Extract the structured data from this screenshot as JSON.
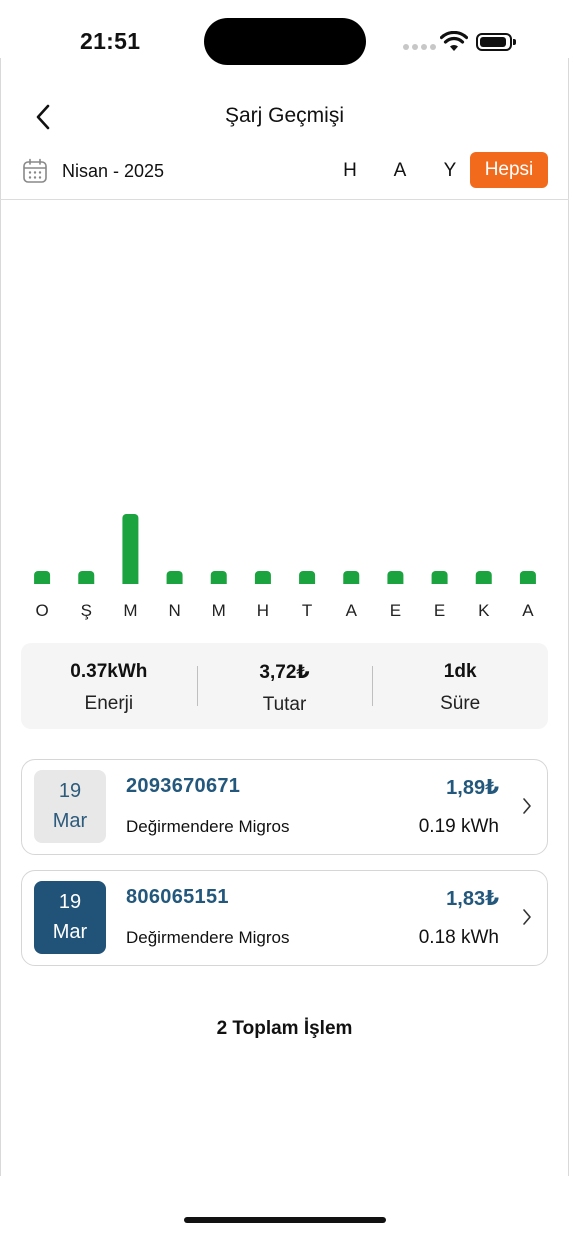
{
  "status": {
    "time": "21:51"
  },
  "nav": {
    "title": "Şarj Geçmişi"
  },
  "filter": {
    "month": "Nisan - 2025",
    "options": [
      "H",
      "A",
      "Y"
    ],
    "active": "Hepsi",
    "accent_color": "#f26b1d"
  },
  "chart_data": {
    "type": "bar",
    "categories": [
      "O",
      "Ş",
      "M",
      "N",
      "M",
      "H",
      "T",
      "A",
      "E",
      "E",
      "K",
      "A"
    ],
    "values": [
      0,
      0,
      0.37,
      0,
      0,
      0,
      0,
      0,
      0,
      0,
      0,
      0
    ],
    "bar_color": "#1aa33f",
    "title": "",
    "xlabel": "",
    "ylabel": ""
  },
  "summary": {
    "energy_value": "0.37kWh",
    "energy_label": "Enerji",
    "amount_value": "3,72₺",
    "amount_label": "Tutar",
    "duration_value": "1dk",
    "duration_label": "Süre"
  },
  "transactions": [
    {
      "day": "19",
      "month": "Mar",
      "id": "2093670671",
      "location": "Değirmendere Migros",
      "amount": "1,89₺",
      "energy": "0.19 kWh"
    },
    {
      "day": "19",
      "month": "Mar",
      "id": "806065151",
      "location": "Değirmendere Migros",
      "amount": "1,83₺",
      "energy": "0.18 kWh"
    }
  ],
  "footer": {
    "total_text": "2 Toplam İşlem"
  }
}
